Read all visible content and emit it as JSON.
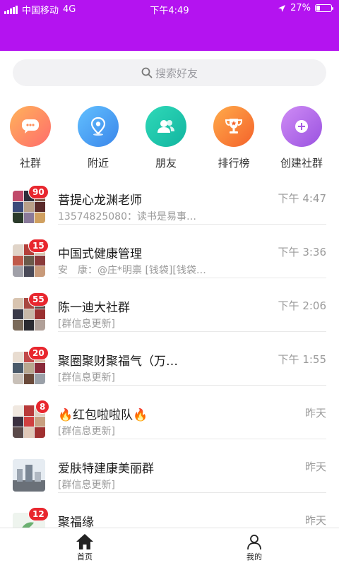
{
  "status_bar": {
    "carrier": "中国移动",
    "network": "4G",
    "time": "下午4:49",
    "battery": "27%",
    "battery_level": 0.27
  },
  "colors": {
    "header": "#b413f0",
    "badge": "#e8262e"
  },
  "search": {
    "placeholder": "搜索好友",
    "icon": "search-icon"
  },
  "shortcuts": [
    {
      "label": "社群",
      "icon": "chat-bubble-icon",
      "color": "#ff8f5a"
    },
    {
      "label": "附近",
      "icon": "location-pin-icon",
      "color": "#4ea6f2"
    },
    {
      "label": "朋友",
      "icon": "people-icon",
      "color": "#1ec9ad"
    },
    {
      "label": "排行榜",
      "icon": "trophy-icon",
      "color": "#fb7a3c"
    },
    {
      "label": "创建社群",
      "icon": "plus-circle-icon",
      "color": "#b46ae6"
    }
  ],
  "groups": [
    {
      "name": "菩提心龙渊老师",
      "preview": "13574825080：读书是易事…",
      "time": "下午 4:47",
      "badge": "90"
    },
    {
      "name": "中国式健康管理",
      "preview": "安　康：@庄*明禀 [钱袋][钱袋…",
      "time": "下午 3:36",
      "badge": "15"
    },
    {
      "name": "陈一迪大社群",
      "preview": "[群信息更新]",
      "time": "下午 2:06",
      "badge": "55"
    },
    {
      "name": "聚圈聚财聚福气（万…",
      "preview": "[群信息更新]",
      "time": "下午 1:55",
      "badge": "20"
    },
    {
      "name": "🔥红包啦啦队🔥",
      "preview": "[群信息更新]",
      "time": "昨天",
      "badge": "8"
    },
    {
      "name": "爱肤特建康美丽群",
      "preview": "[群信息更新]",
      "time": "昨天",
      "badge": ""
    },
    {
      "name": "聚福缘",
      "preview": "",
      "time": "昨天",
      "badge": "12"
    }
  ],
  "tabbar": {
    "home": "首页",
    "mine": "我的"
  }
}
